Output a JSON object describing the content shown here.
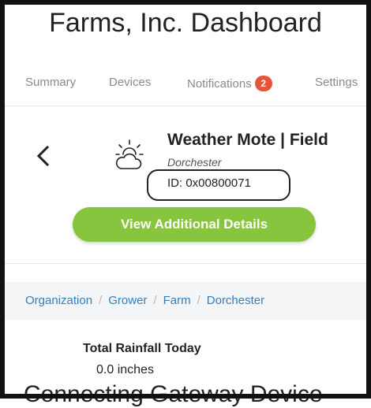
{
  "app": {
    "title": "Farms, Inc. Dashboard"
  },
  "nav": {
    "items": [
      {
        "label": "Summary"
      },
      {
        "label": "Devices"
      },
      {
        "label": "Notifications",
        "badge": "2"
      },
      {
        "label": "Settings"
      }
    ]
  },
  "device": {
    "name": "Weather Mote | Field",
    "location": "Dorchester",
    "id": "ID: 0x00800071",
    "icon": "weather-partly-cloudy-icon"
  },
  "actions": {
    "details_label": "View Additional Details"
  },
  "breadcrumb": {
    "items": [
      "Organization",
      "Grower",
      "Farm",
      "Dorchester"
    ],
    "separator": "/"
  },
  "rainfall": {
    "label": "Total Rainfall Today",
    "value": "0.0 inches"
  },
  "section": {
    "heading": "Connecting Gateway Device"
  },
  "colors": {
    "accent_green": "#86c53d",
    "badge_red": "#e6553b",
    "link_blue": "#2f7fbf"
  }
}
